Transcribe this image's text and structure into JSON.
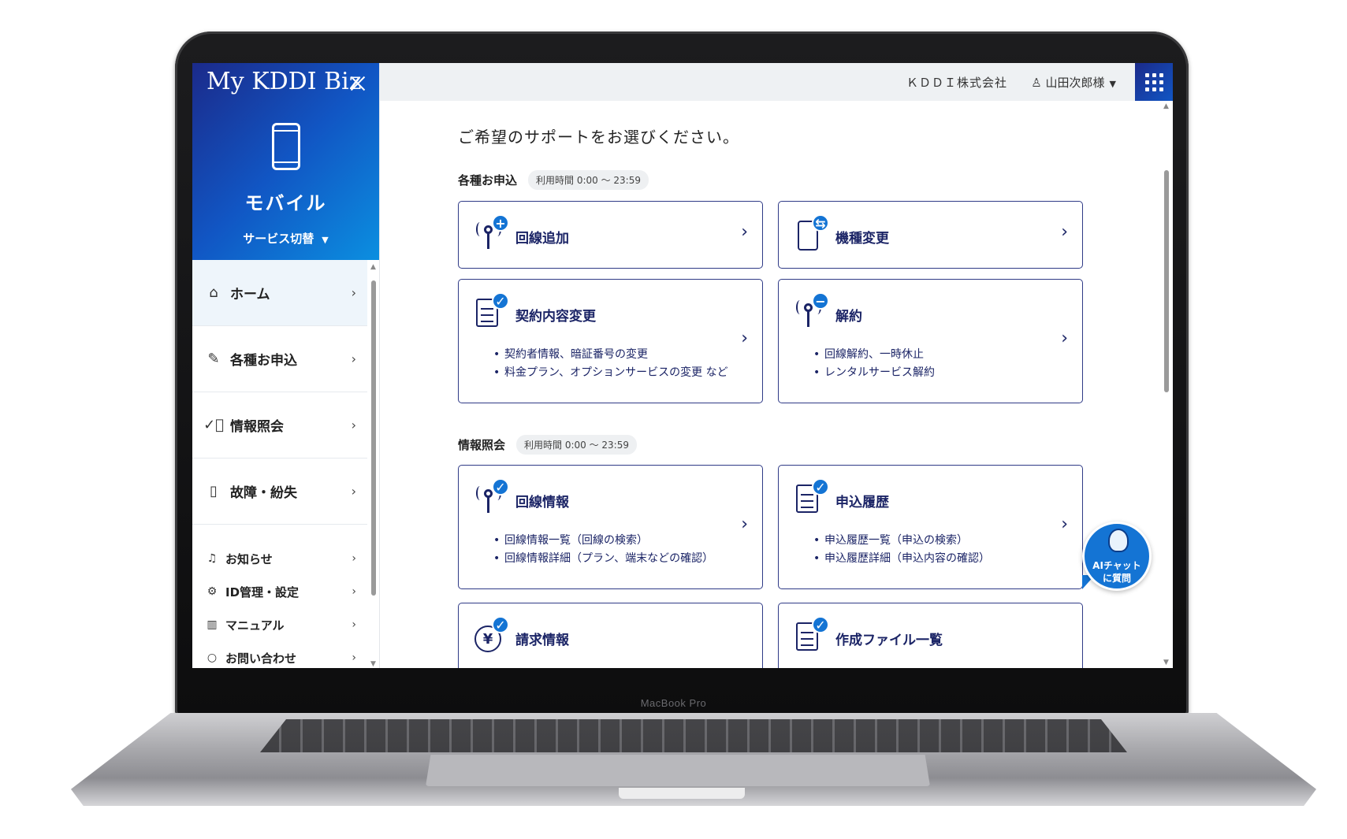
{
  "device": {
    "brand_label": "MacBook Pro"
  },
  "sidebar": {
    "brand": "My KDDI Biz",
    "service_name": "モバイル",
    "service_switch_label": "サービス切替",
    "items": [
      {
        "label": "ホーム",
        "icon": "home-icon"
      },
      {
        "label": "各種お申込",
        "icon": "pencil-icon"
      },
      {
        "label": "情報照会",
        "icon": "check-circle-icon"
      },
      {
        "label": "故障・紛失",
        "icon": "broken-phone-icon"
      }
    ],
    "subitems": [
      {
        "label": "お知らせ",
        "icon": "bell-icon"
      },
      {
        "label": "ID管理・設定",
        "icon": "gear-icon"
      },
      {
        "label": "マニュアル",
        "icon": "book-icon"
      },
      {
        "label": "お問い合わせ",
        "icon": "help-icon"
      }
    ]
  },
  "header": {
    "company": "ＫＤＤＩ株式会社",
    "user": "山田次郎様"
  },
  "main": {
    "title": "ご希望のサポートをお選びください。",
    "sections": [
      {
        "title": "各種お申込",
        "hours": "利用時間 0:00 ～ 23:59",
        "cards": [
          {
            "title": "回線追加",
            "icon": "antenna-plus-icon",
            "bullets": []
          },
          {
            "title": "機種変更",
            "icon": "phone-swap-icon",
            "bullets": []
          },
          {
            "title": "契約内容変更",
            "icon": "document-check-icon",
            "bullets": [
              "契約者情報、暗証番号の変更",
              "料金プラン、オプションサービスの変更 など"
            ]
          },
          {
            "title": "解約",
            "icon": "antenna-minus-icon",
            "bullets": [
              "回線解約、一時休止",
              "レンタルサービス解約"
            ]
          }
        ]
      },
      {
        "title": "情報照会",
        "hours": "利用時間 0:00 ～ 23:59",
        "cards": [
          {
            "title": "回線情報",
            "icon": "antenna-check-icon",
            "bullets": [
              "回線情報一覧（回線の検索）",
              "回線情報詳細（プラン、端末などの確認）"
            ]
          },
          {
            "title": "申込履歴",
            "icon": "document-check-icon",
            "bullets": [
              "申込履歴一覧（申込の検索）",
              "申込履歴詳細（申込内容の確認）"
            ]
          },
          {
            "title": "請求情報",
            "icon": "yen-check-icon",
            "bullets": []
          },
          {
            "title": "作成ファイル一覧",
            "icon": "document-check-icon",
            "bullets": []
          }
        ]
      }
    ]
  },
  "ai_chat": {
    "line1": "AIチャット",
    "line2": "に質問"
  },
  "colors": {
    "brand_dark": "#1b2a8a",
    "brand_blue": "#1156c4",
    "accent": "#1474d4",
    "card_border": "#2f3a86"
  }
}
